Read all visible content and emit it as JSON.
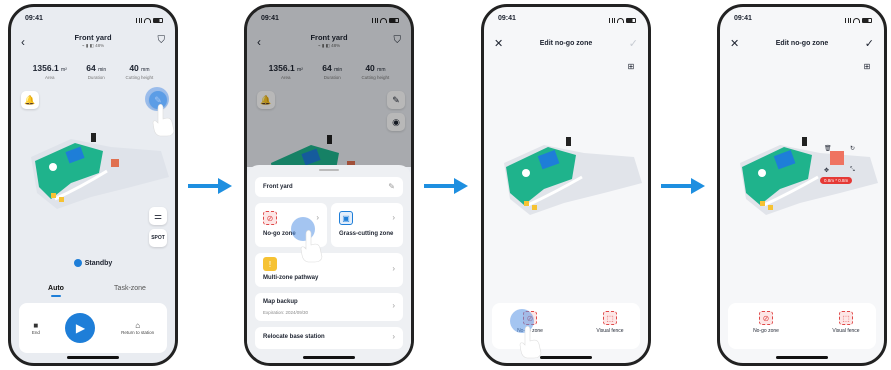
{
  "status_time": "09:41",
  "colors": {
    "accent": "#1e7ed8",
    "lawn": "#1fb38c",
    "zone_red": "#e04848",
    "path": "#f6c233"
  },
  "screen1": {
    "title": "Front yard",
    "subtitle": "⌁ ▮ ◧ 48%",
    "stats": [
      {
        "value": "1356.1",
        "unit": "m²",
        "label": "Area"
      },
      {
        "value": "64",
        "unit": "min",
        "label": "Duration"
      },
      {
        "value": "40",
        "unit": "mm",
        "label": "Cutting height"
      }
    ],
    "spot_label": "SPOT",
    "standby": "Standby",
    "modes": [
      "Auto",
      "Task-zone"
    ],
    "controls": {
      "end": "End",
      "return": "Return to station"
    }
  },
  "screen2": {
    "title": "Front yard",
    "subtitle": "⌁ ▮ ◧ 48%",
    "stats": [
      {
        "value": "1356.1",
        "unit": "m²",
        "label": "Area"
      },
      {
        "value": "64",
        "unit": "min",
        "label": "Duration"
      },
      {
        "value": "40",
        "unit": "mm",
        "label": "Cutting height"
      }
    ],
    "sheet": {
      "map_name": "Front yard",
      "no_go": "No-go zone",
      "grass": "Grass-cutting zone",
      "multi": "Multi-zone pathway",
      "backup_title": "Map backup",
      "backup_sub": "Expiration: 2024/09/30",
      "relocate": "Relocate base station"
    }
  },
  "screen3": {
    "title": "Edit no-go zone",
    "tools": {
      "no_go": "No-go zone",
      "fence": "Visual fence"
    }
  },
  "screen4": {
    "title": "Edit no-go zone",
    "size_badge": "0.8m * 0.8m",
    "tools": {
      "no_go": "No-go zone",
      "fence": "Visual fence"
    }
  }
}
